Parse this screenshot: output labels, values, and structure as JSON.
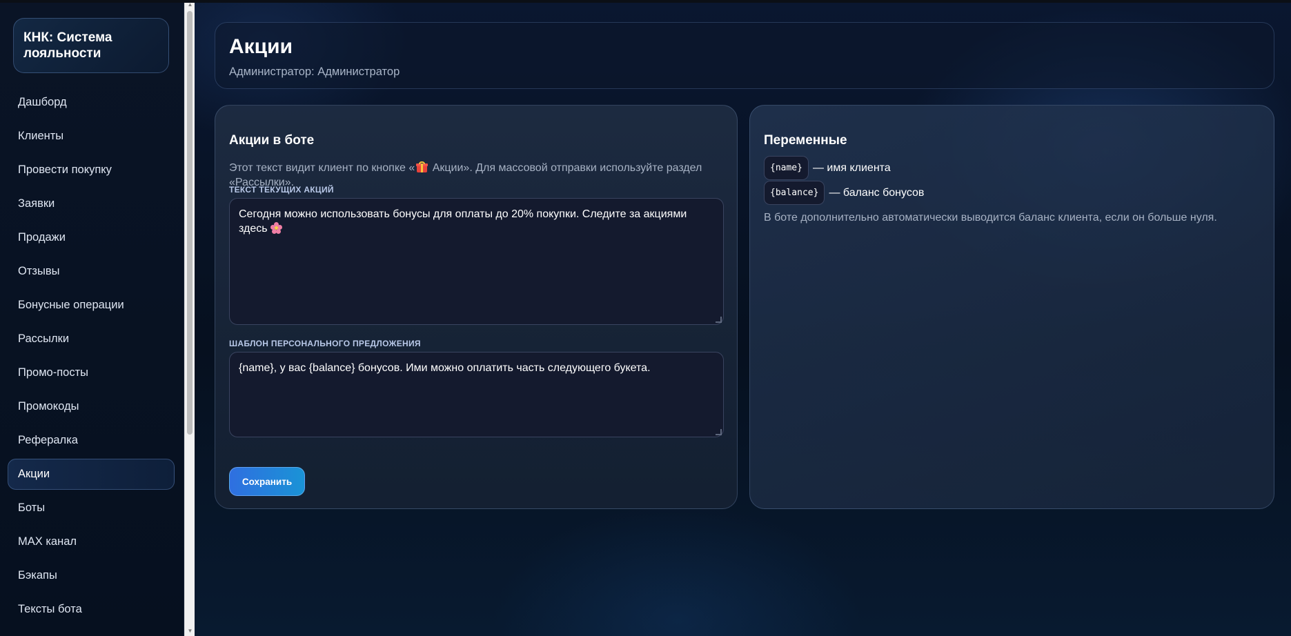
{
  "app": {
    "title": "КНК: Система лояльности"
  },
  "sidebar": {
    "items": [
      {
        "label": "Дашборд"
      },
      {
        "label": "Клиенты"
      },
      {
        "label": "Провести покупку"
      },
      {
        "label": "Заявки"
      },
      {
        "label": "Продажи"
      },
      {
        "label": "Отзывы"
      },
      {
        "label": "Бонусные операции"
      },
      {
        "label": "Рассылки"
      },
      {
        "label": "Промо-посты"
      },
      {
        "label": "Промокоды"
      },
      {
        "label": "Рефералка"
      },
      {
        "label": "Акции",
        "active": true
      },
      {
        "label": "Боты"
      },
      {
        "label": "MAX канал"
      },
      {
        "label": "Бэкапы"
      },
      {
        "label": "Тексты бота"
      }
    ]
  },
  "header": {
    "title": "Акции",
    "subtitle": "Администратор: Администратор"
  },
  "promo_card": {
    "title": "Акции в боте",
    "desc_before": "Этот текст видит клиент по кнопке «",
    "desc_button": "Акции",
    "desc_after": "». Для массовой отправки используйте раздел «Рассылки».",
    "current_label": "ТЕКСТ ТЕКУЩИХ АКЦИЙ",
    "current_value": "Сегодня можно использовать бонусы для оплаты до 20% покупки. Следите за акциями здесь",
    "template_label": "ШАБЛОН ПЕРСОНАЛЬНОГО ПРЕДЛОЖЕНИЯ",
    "template_value": "{name}, у вас {balance} бонусов. Ими можно оплатить часть следующего букета.",
    "save_label": "Сохранить"
  },
  "variables_card": {
    "title": "Переменные",
    "vars": [
      {
        "token": "{name}",
        "desc": "— имя клиента"
      },
      {
        "token": "{balance}",
        "desc": "— баланс бонусов"
      }
    ],
    "note": "В боте дополнительно автоматически выводится баланс клиента, если он больше нуля."
  },
  "icons": {
    "gift": "gift-icon",
    "flower": "flower-icon"
  },
  "colors": {
    "accent": "#2f6fe0",
    "background": "#061121"
  }
}
